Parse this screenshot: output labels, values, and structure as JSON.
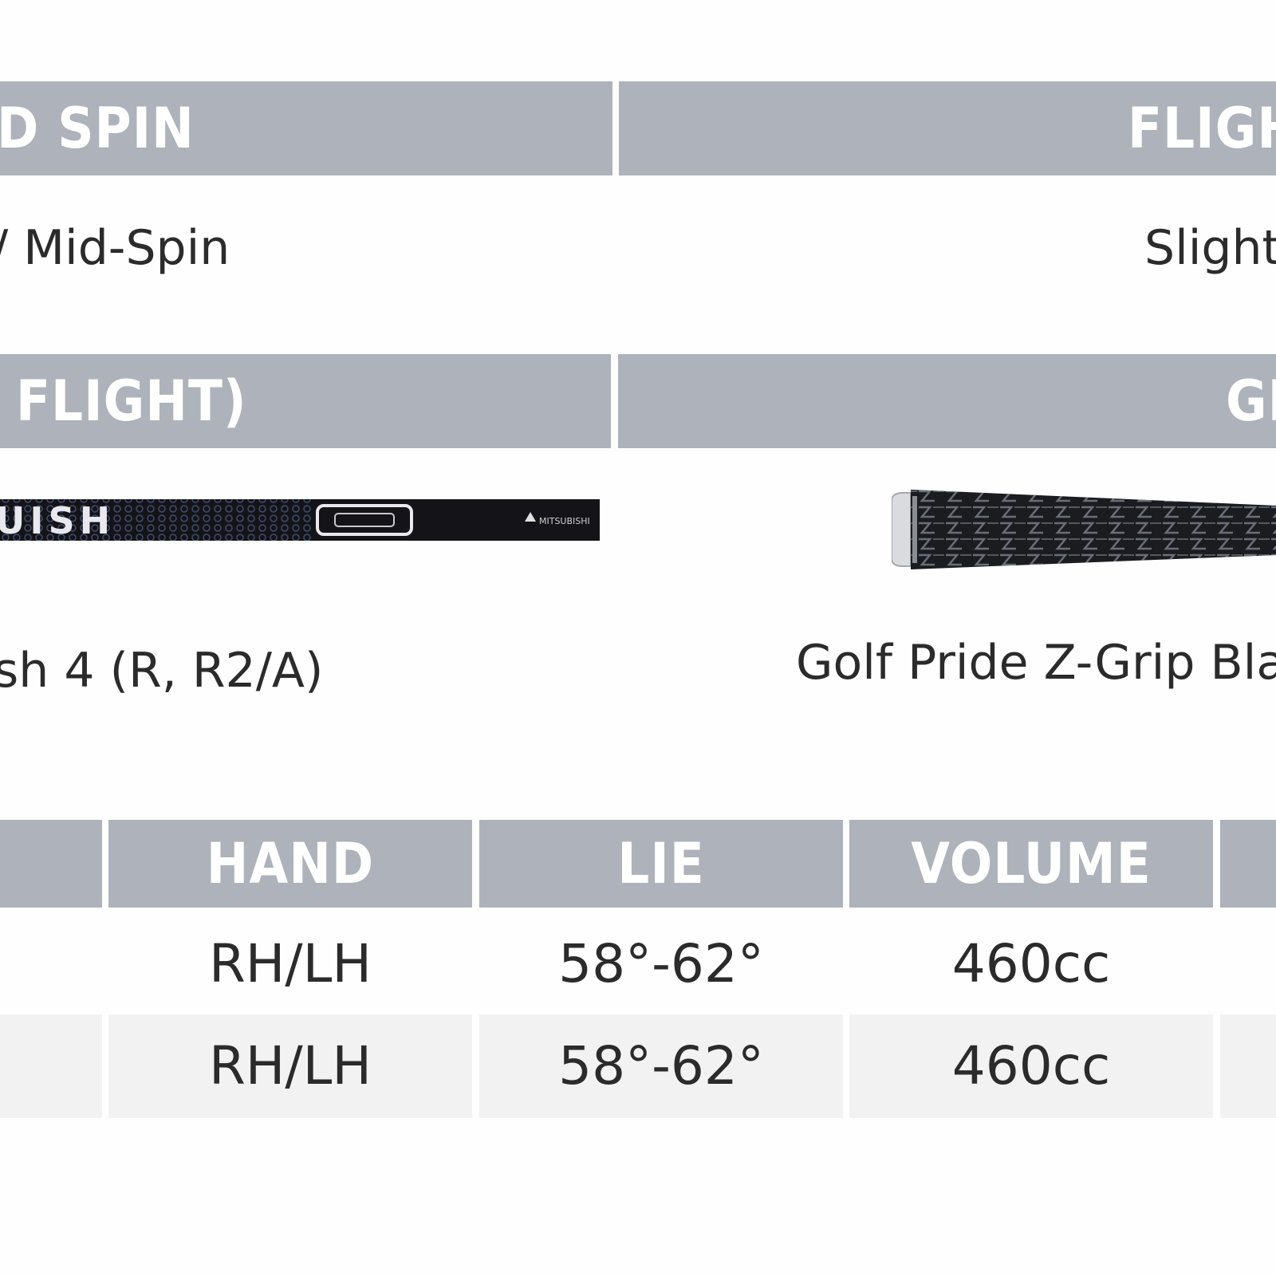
{
  "spec_rows": [
    {
      "left_header": "D SPIN",
      "right_header": "FLIGH",
      "left_value": "/ Mid-Spin",
      "right_value": "Slight"
    },
    {
      "left_header": "FLIGHT)",
      "right_header": "GF",
      "left_value": "sh 4 (R, R2/A)",
      "right_value": "Golf Pride Z-Grip Bla"
    }
  ],
  "shaft_image": {
    "label": "UISH",
    "brand": "MITSUBISHI",
    "icon": "shaft-image"
  },
  "grip_image": {
    "icon": "grip-image"
  },
  "table": {
    "headers": [
      "",
      "HAND",
      "LIE",
      "VOLUME",
      ""
    ],
    "rows": [
      [
        "",
        "RH/LH",
        "58°-62°",
        "460cc",
        ""
      ],
      [
        "",
        "RH/LH",
        "58°-62°",
        "460cc",
        ""
      ]
    ]
  },
  "colors": {
    "header_bg": "#aeb2ba",
    "header_text": "#ffffff",
    "alt_row_bg": "#f2f2f2",
    "text": "#2b2b2b"
  }
}
